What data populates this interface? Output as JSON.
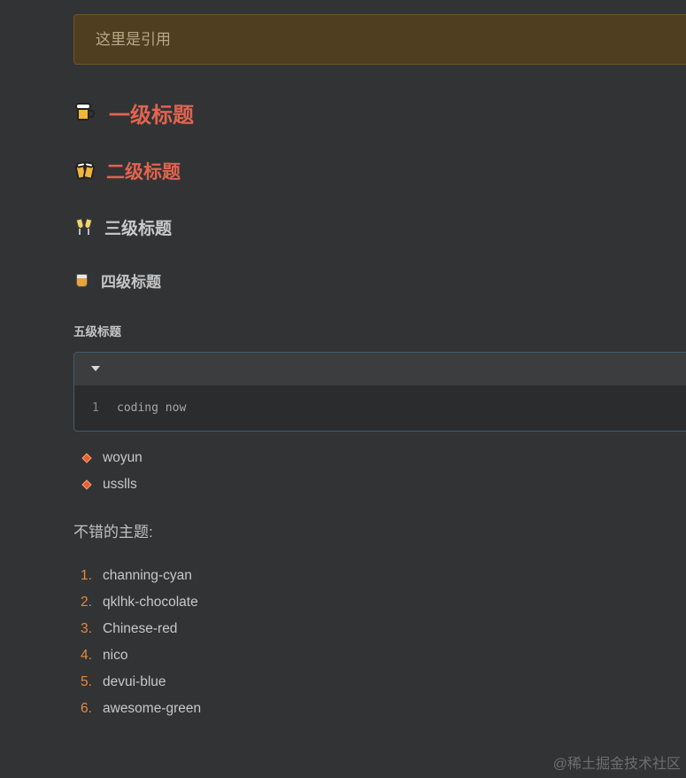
{
  "blockquote": {
    "text": "这里是引用"
  },
  "headings": {
    "h1": {
      "text": "一级标题",
      "icon": "beer-mug-icon"
    },
    "h2": {
      "text": "二级标题",
      "icon": "clinking-beer-mugs-icon"
    },
    "h3": {
      "text": "三级标题",
      "icon": "clinking-glasses-icon"
    },
    "h4": {
      "text": "四级标题",
      "icon": "tumbler-glass-icon"
    },
    "h5": {
      "text": "五级标题"
    }
  },
  "code_block": {
    "lines": [
      {
        "number": "1",
        "text": "coding now"
      }
    ]
  },
  "bullet_list": {
    "items": [
      "woyun",
      "usslls"
    ]
  },
  "paragraph": {
    "text": "不错的主题:"
  },
  "ordered_list": {
    "items": [
      {
        "number": "1.",
        "text": "channing-cyan"
      },
      {
        "number": "2.",
        "text": "qklhk-chocolate"
      },
      {
        "number": "3.",
        "text": "Chinese-red"
      },
      {
        "number": "4.",
        "text": "nico"
      },
      {
        "number": "5.",
        "text": "devui-blue"
      },
      {
        "number": "6.",
        "text": "awesome-green"
      }
    ]
  },
  "watermark": {
    "text": "@稀土掘金技术社区"
  },
  "colors": {
    "background": "#323335",
    "heading_accent": "#e06450",
    "quote_background": "#503e20",
    "bullet": "#e9602b",
    "list_number": "#e8883a"
  }
}
